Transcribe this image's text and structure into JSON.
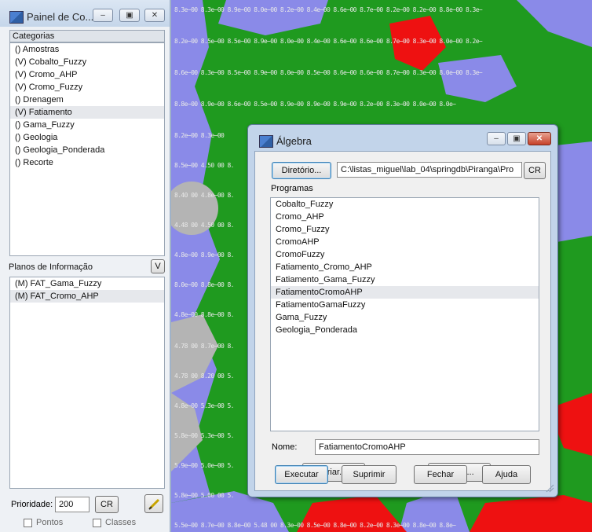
{
  "panel": {
    "title": "Painel de Co...",
    "buttons": {
      "minimize": "–",
      "restore": "▣",
      "close": "✕"
    },
    "categories_header": "Categorias",
    "categories": [
      "() Amostras",
      "(V) Cobalto_Fuzzy",
      "(V) Cromo_AHP",
      "(V) Cromo_Fuzzy",
      "() Drenagem",
      "(V) Fatiamento",
      "() Gama_Fuzzy",
      "() Geologia",
      "() Geologia_Ponderada",
      "() Recorte"
    ],
    "selected_category_index": 5,
    "planos_header": "Planos de Informação",
    "planos_button": "V",
    "planos": [
      "(M) FAT_Gama_Fuzzy",
      "(M) FAT_Cromo_AHP"
    ],
    "selected_plano_index": 1,
    "prioridade_label": "Prioridade:",
    "prioridade_value": "200",
    "cr_label": "CR",
    "pontos_label": "Pontos",
    "classes_label": "Classes"
  },
  "dialog": {
    "title": "Álgebra",
    "diretorio_button": "Diretório...",
    "diretorio_path": "C:\\listas_miguel\\lab_04\\springdb\\Piranga\\Pro",
    "cr_button": "CR",
    "programas_label": "Programas",
    "programas": [
      "Cobalto_Fuzzy",
      "Cromo_AHP",
      "Cromo_Fuzzy",
      "CromoAHP",
      "CromoFuzzy",
      "Fatiamento_Cromo_AHP",
      "Fatiamento_Gama_Fuzzy",
      "FatiamentoCromoAHP",
      "FatiamentoGamaFuzzy",
      "Gama_Fuzzy",
      "Geologia_Ponderada"
    ],
    "selected_programa_index": 7,
    "nome_label": "Nome:",
    "nome_value": "FatiamentoCromoAHP",
    "criar_button": "Criar...",
    "editar_button": "Editar...",
    "executar_button": "Executar",
    "suprimir_button": "Suprimir",
    "fechar_button": "Fechar",
    "ajuda_button": "Ajuda"
  },
  "colors": {
    "map_green": "#1f9a1f",
    "map_blue": "#8a8ae8",
    "map_gray": "#b4b4b4",
    "map_red": "#ee1111",
    "dialog_frame": "#c2d4ea"
  }
}
